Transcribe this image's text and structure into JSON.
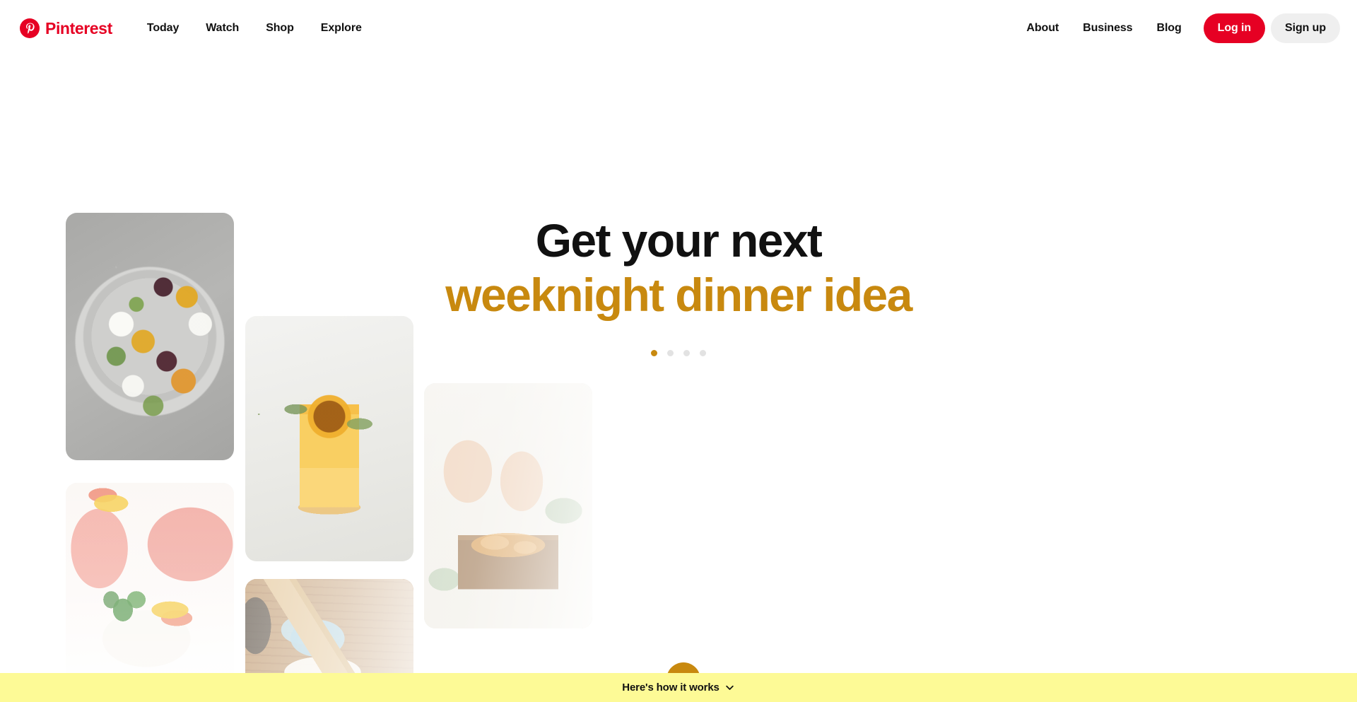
{
  "brand": {
    "name": "Pinterest",
    "logo_color": "#e60023"
  },
  "header": {
    "nav_left": [
      {
        "label": "Today"
      },
      {
        "label": "Watch"
      },
      {
        "label": "Shop"
      },
      {
        "label": "Explore"
      }
    ],
    "nav_right": [
      {
        "label": "About"
      },
      {
        "label": "Business"
      },
      {
        "label": "Blog"
      }
    ],
    "login_label": "Log in",
    "signup_label": "Sign up",
    "login_bg": "#e60023",
    "signup_bg": "#efefef"
  },
  "hero": {
    "headline_line1": "Get your next",
    "headline_line2": "weeknight dinner idea",
    "headline_line1_color": "#111111",
    "headline_line2_color": "#c8890f",
    "carousel": {
      "total": 4,
      "active_index": 0,
      "active_color": "#c8890f",
      "inactive_color": "#e2e2e2"
    },
    "scroll_button": {
      "icon": "chevron-down-icon",
      "background": "#c8890f"
    },
    "collage": [
      {
        "name": "beet-and-goat-cheese-salad-plate"
      },
      {
        "name": "pink-lemonade-with-mint"
      },
      {
        "name": "citrus-cocktail-with-thyme"
      },
      {
        "name": "baking-rolling-pin-and-oven-mitt"
      },
      {
        "name": "hands-tossing-salad-in-wooden-bowl"
      }
    ]
  },
  "bottom_bar": {
    "label": "Here's how it works",
    "icon": "chevron-down-icon",
    "background": "#fdfa96"
  }
}
